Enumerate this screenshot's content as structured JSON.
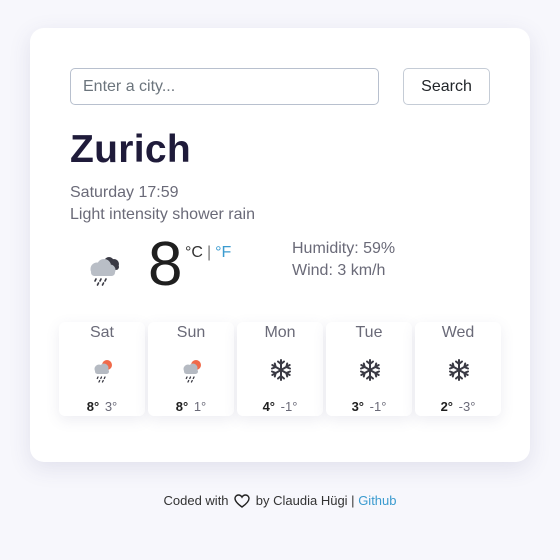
{
  "search": {
    "placeholder": "Enter a city...",
    "value": "",
    "button_label": "Search"
  },
  "current": {
    "city": "Zurich",
    "datetime": "Saturday 17:59",
    "description": "Light intensity shower rain",
    "icon": "shower-rain-night-icon",
    "temperature": "8",
    "unit_c": "°C",
    "unit_sep": "|",
    "unit_f": "°F",
    "humidity": "Humidity: 59%",
    "wind": "Wind: 3 km/h"
  },
  "forecast": [
    {
      "day": "Sat",
      "icon": "shower-rain-sun-icon",
      "max": "8°",
      "min": "3°"
    },
    {
      "day": "Sun",
      "icon": "shower-rain-sun-icon",
      "max": "8°",
      "min": "1°"
    },
    {
      "day": "Mon",
      "icon": "snow-icon",
      "max": "4°",
      "min": "-1°"
    },
    {
      "day": "Tue",
      "icon": "snow-icon",
      "max": "3°",
      "min": "-1°"
    },
    {
      "day": "Wed",
      "icon": "snow-icon",
      "max": "2°",
      "min": "-3°"
    }
  ],
  "footer": {
    "prefix": "Coded with",
    "icon": "heart-icon",
    "middle": "by Claudia Hügi |",
    "link": "Github"
  },
  "colors": {
    "accent": "#3b9bcf",
    "title": "#1f1b3a",
    "sun": "#f06a4a",
    "cloud": "#8a8f98"
  }
}
